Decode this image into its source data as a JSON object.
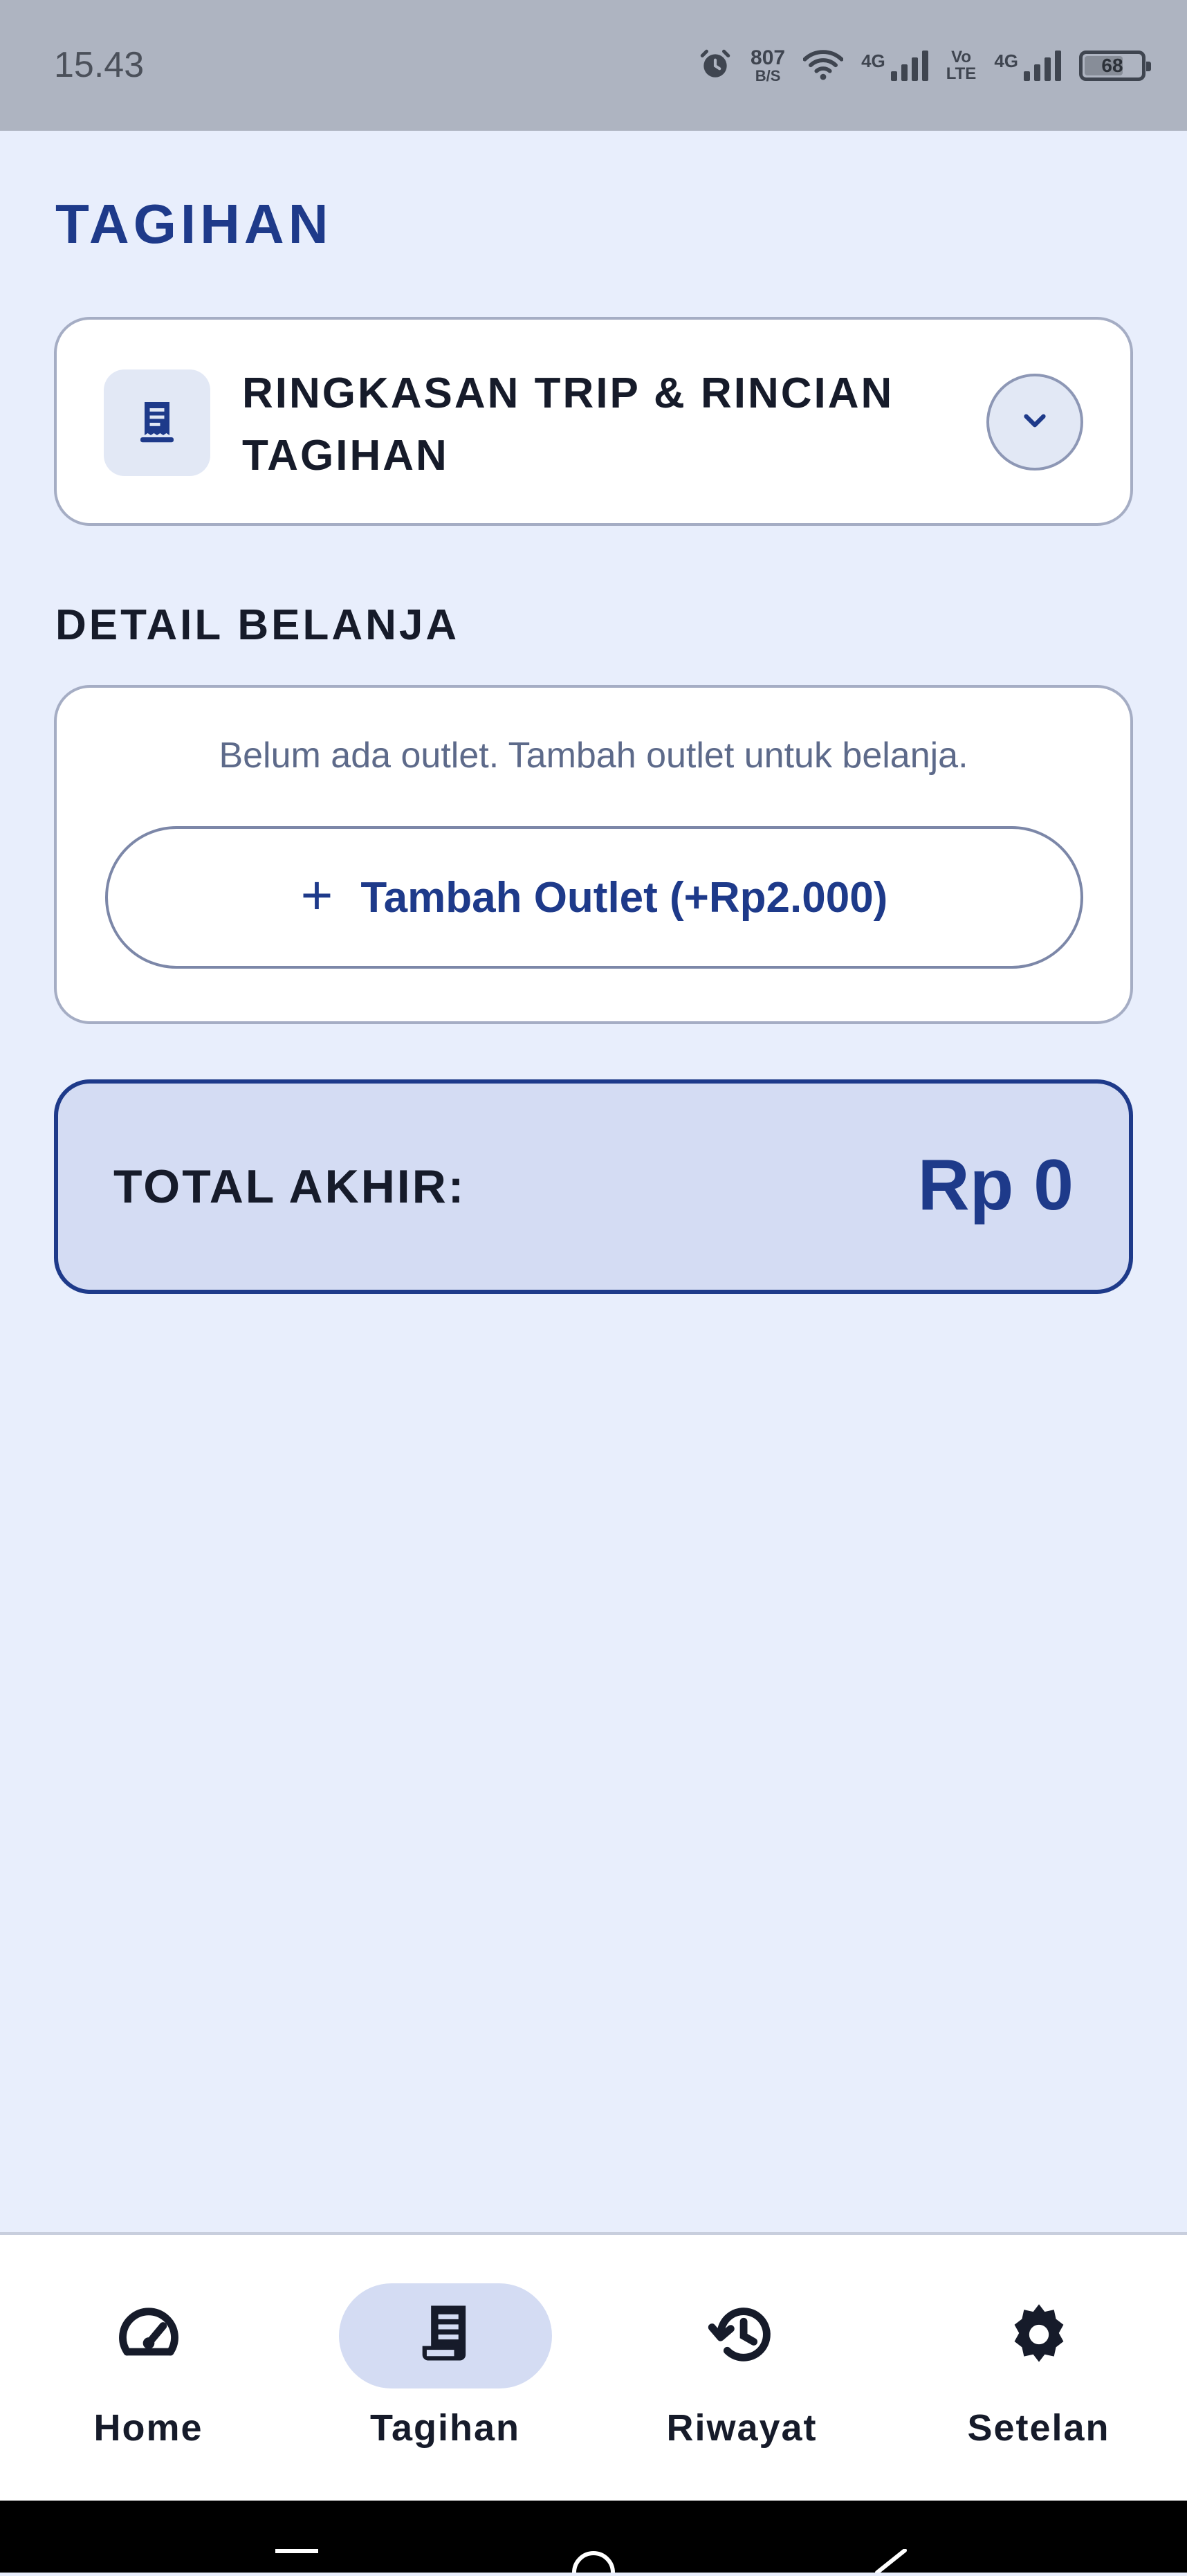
{
  "status_bar": {
    "time": "15.43",
    "net_speed_value": "807",
    "net_speed_unit": "B/S",
    "signal_label_1": "4G",
    "volte_top": "Vo",
    "volte_bottom": "LTE",
    "signal_label_2": "4G",
    "battery": "68"
  },
  "page": {
    "title": "TAGIHAN"
  },
  "summary": {
    "title": "RINGKASAN TRIP & RINCIAN TAGIHAN",
    "icon": "receipt-icon",
    "toggle_icon": "chevron-down-icon"
  },
  "detail": {
    "section_label": "DETAIL BELANJA",
    "empty_message": "Belum ada outlet. Tambah outlet untuk belanja.",
    "add_button_label": "Tambah Outlet (+Rp2.000)"
  },
  "total": {
    "label": "TOTAL AKHIR:",
    "value": "Rp 0"
  },
  "bottom_nav": {
    "items": [
      {
        "label": "Home",
        "icon": "speedometer-icon",
        "active": false
      },
      {
        "label": "Tagihan",
        "icon": "receipt-icon",
        "active": true
      },
      {
        "label": "Riwayat",
        "icon": "history-icon",
        "active": false
      },
      {
        "label": "Setelan",
        "icon": "gear-icon",
        "active": false
      }
    ]
  },
  "colors": {
    "background": "#e8eefc",
    "accent": "#1e3a8a",
    "card": "#ffffff",
    "total_card": "#d4dcf3",
    "status_bar": "#aeb4c1"
  }
}
